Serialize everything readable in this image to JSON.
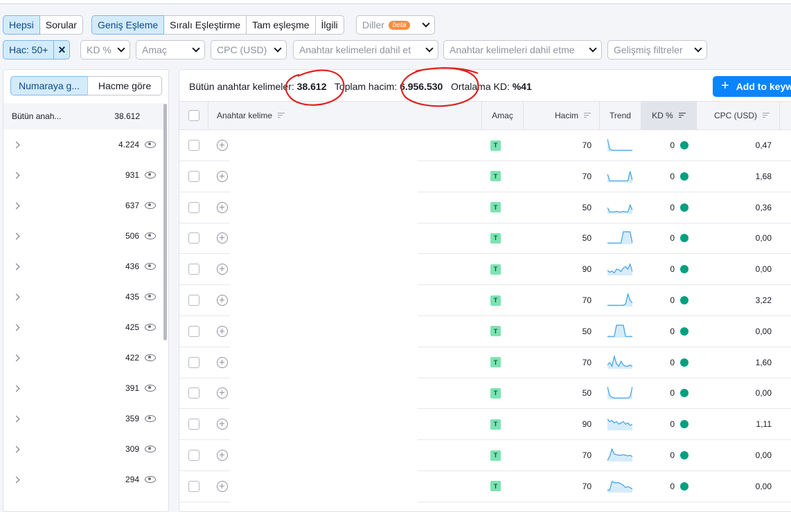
{
  "filters": {
    "scope_tabs": [
      "Hepsi",
      "Sorular"
    ],
    "match_tabs": [
      "Geniş Eşleme",
      "Sıralı Eşleştirme",
      "Tam eşleşme",
      "İlgili"
    ],
    "languages": {
      "label": "Diller",
      "badge": "beta"
    },
    "volume_chip": "Hac: 50+",
    "dropdowns": [
      "KD %",
      "Amaç",
      "CPC (USD)",
      "Anahtar kelimeleri dahil et",
      "Anahtar kelimeleri dahil etme",
      "Gelişmiş filtreler"
    ]
  },
  "sidebar": {
    "tabs": [
      "Numaraya g...",
      "Hacme göre"
    ],
    "header": {
      "label": "Bütün anah...",
      "count": "38.612"
    },
    "groups": [
      "4.224",
      "931",
      "637",
      "506",
      "436",
      "435",
      "425",
      "422",
      "391",
      "359",
      "309",
      "294"
    ]
  },
  "summary": {
    "all_keywords_label": "Bütün anahtar kelimeler:",
    "all_keywords_value": "38.612",
    "total_volume_label": "Toplam hacim:",
    "total_volume_value": "6.956.530",
    "avg_kd_label": "Ortalama KD:",
    "avg_kd_value": "%41"
  },
  "add_button": "Add to keyw",
  "table": {
    "columns": [
      "Anahtar kelime",
      "Amaç",
      "Hacim",
      "Trend",
      "KD %",
      "CPC (USD)"
    ],
    "rows": [
      {
        "intent": "T",
        "volume": "70",
        "kd": "0",
        "cpc": "0,47",
        "trend": [
          1.0,
          0.2,
          0.1,
          0.1,
          0.1,
          0.1,
          0.1,
          0.1,
          0.1,
          0.1,
          0.1,
          0.1
        ]
      },
      {
        "intent": "T",
        "volume": "70",
        "kd": "0",
        "cpc": "1,68",
        "trend": [
          0.7,
          0.15,
          0.15,
          0.15,
          0.15,
          0.15,
          0.15,
          0.15,
          0.15,
          0.15,
          0.9,
          0.2
        ]
      },
      {
        "intent": "T",
        "volume": "50",
        "kd": "0",
        "cpc": "0,36",
        "trend": [
          0.5,
          0.15,
          0.15,
          0.15,
          0.2,
          0.15,
          0.15,
          0.2,
          0.15,
          0.15,
          0.7,
          0.3
        ]
      },
      {
        "intent": "T",
        "volume": "50",
        "kd": "0",
        "cpc": "0,00",
        "trend": [
          0.1,
          0.1,
          0.1,
          0.1,
          0.1,
          0.1,
          0.1,
          1.0,
          1.0,
          1.0,
          1.0,
          0.1
        ]
      },
      {
        "intent": "T",
        "volume": "90",
        "kd": "0",
        "cpc": "0,00",
        "trend": [
          0.4,
          0.25,
          0.35,
          0.2,
          0.5,
          0.45,
          0.3,
          0.6,
          0.7,
          0.5,
          0.9,
          0.3
        ]
      },
      {
        "intent": "T",
        "volume": "70",
        "kd": "0",
        "cpc": "3,22",
        "trend": [
          0.1,
          0.1,
          0.1,
          0.1,
          0.1,
          0.1,
          0.1,
          0.1,
          0.2,
          1.0,
          0.5,
          0.3
        ]
      },
      {
        "intent": "T",
        "volume": "50",
        "kd": "0",
        "cpc": "0,00",
        "trend": [
          0.1,
          0.1,
          0.1,
          0.1,
          1.0,
          1.0,
          1.0,
          1.0,
          0.1,
          0.1,
          0.1,
          0.1
        ]
      },
      {
        "intent": "T",
        "volume": "70",
        "kd": "0",
        "cpc": "1,60",
        "trend": [
          0.3,
          0.5,
          0.2,
          1.0,
          0.4,
          0.2,
          0.6,
          0.3,
          0.2,
          0.2,
          0.3,
          0.2
        ]
      },
      {
        "intent": "T",
        "volume": "50",
        "kd": "0",
        "cpc": "0,00",
        "trend": [
          1.0,
          0.3,
          0.15,
          0.1,
          0.1,
          0.1,
          0.1,
          0.1,
          0.1,
          0.1,
          0.2,
          1.0
        ]
      },
      {
        "intent": "T",
        "volume": "90",
        "kd": "0",
        "cpc": "1,11",
        "trend": [
          0.9,
          0.7,
          0.8,
          0.6,
          0.7,
          0.5,
          0.6,
          0.7,
          0.5,
          0.6,
          0.4,
          0.5
        ]
      },
      {
        "intent": "T",
        "volume": "70",
        "kd": "0",
        "cpc": "0,00",
        "trend": [
          0.1,
          0.4,
          1.0,
          0.6,
          0.55,
          0.5,
          0.5,
          0.55,
          0.5,
          0.45,
          0.5,
          0.4
        ]
      },
      {
        "intent": "T",
        "volume": "70",
        "kd": "0",
        "cpc": "0,00",
        "trend": [
          0.2,
          0.2,
          0.9,
          0.8,
          0.8,
          0.8,
          0.7,
          0.6,
          0.4,
          0.5,
          0.4,
          0.3
        ]
      }
    ]
  },
  "colors": {
    "accent": "#0a84ff",
    "kd_dot": "#009f81",
    "intent_badge": "#7de3b3",
    "annotation": "#e0231f",
    "trend_line": "#3aa0e6"
  }
}
